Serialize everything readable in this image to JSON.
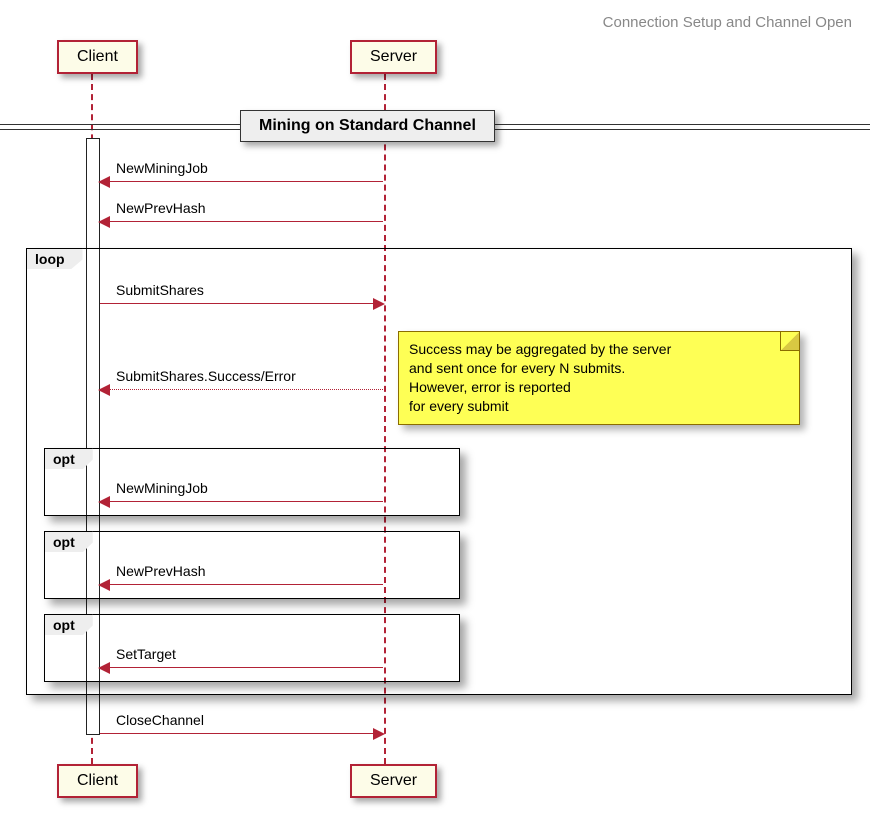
{
  "title": "Connection Setup and Channel Open",
  "participants": {
    "client": "Client",
    "server": "Server"
  },
  "divider": "Mining on Standard Channel",
  "fragments": {
    "loop": "loop",
    "opt": "opt"
  },
  "messages": {
    "new_mining_job": "NewMiningJob",
    "new_prev_hash": "NewPrevHash",
    "submit_shares": "SubmitShares",
    "submit_shares_result": "SubmitShares.Success/Error",
    "set_target": "SetTarget",
    "close_channel": "CloseChannel"
  },
  "note": {
    "line1": "Success may be aggregated by the server",
    "line2": "and sent once for every N submits.",
    "line3": "However, error is reported",
    "line4": "for every submit"
  }
}
